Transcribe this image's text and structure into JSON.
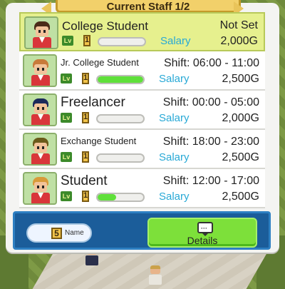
{
  "header": {
    "title": "Current Staff 1/2"
  },
  "staff": [
    {
      "name": "College Student",
      "shift": "Not Set",
      "level": "1",
      "salary_label": "Salary",
      "salary": "2,000G",
      "progress": 0.0,
      "selected": true,
      "hair": "#4a2b18",
      "size": "normal"
    },
    {
      "name": "Jr. College Student",
      "shift": "Shift: 06:00 - 11:00",
      "level": "1",
      "salary_label": "Salary",
      "salary": "2,500G",
      "progress": 1.0,
      "selected": false,
      "hair": "#c87a3a",
      "size": "small"
    },
    {
      "name": "Freelancer",
      "shift": "Shift: 00:00 - 05:00",
      "level": "1",
      "salary_label": "Salary",
      "salary": "2,000G",
      "progress": 0.0,
      "selected": false,
      "hair": "#1c2a5a",
      "size": "big"
    },
    {
      "name": "Exchange Student",
      "shift": "Shift: 18:00 - 23:00",
      "level": "1",
      "salary_label": "Salary",
      "salary": "2,500G",
      "progress": 0.0,
      "selected": false,
      "hair": "#6a5a1a",
      "size": "small"
    },
    {
      "name": "Student",
      "shift": "Shift: 12:00 - 17:00",
      "level": "1",
      "salary_label": "Salary",
      "salary": "2,500G",
      "progress": 0.4,
      "selected": false,
      "hair": "#d89a3a",
      "size": "big"
    }
  ],
  "level_tag": "Lv",
  "footer": {
    "sort_badge": "5",
    "sort_label": "Name",
    "details_label": "Details"
  },
  "colors": {
    "selected_row": "#e6f08e",
    "salary_label": "#28a9d6",
    "progress_fill": "#5fe03a",
    "footer_bg": "#1b5d9a",
    "details_button": "#7de03a"
  }
}
